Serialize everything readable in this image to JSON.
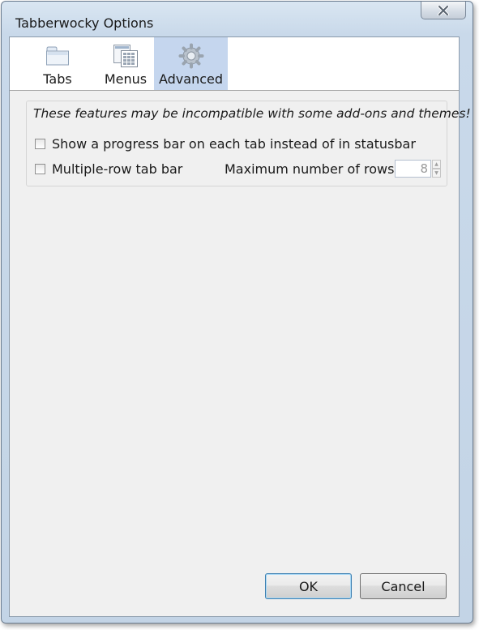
{
  "window": {
    "title": "Tabberwocky Options"
  },
  "toolbar": {
    "items": [
      {
        "label": "Tabs",
        "icon": "tabs-icon"
      },
      {
        "label": "Menus",
        "icon": "menus-icon"
      },
      {
        "label": "Advanced",
        "icon": "gear-icon",
        "selected": true
      }
    ]
  },
  "advanced": {
    "warning": "These features may be incompatible with some add-ons and themes!",
    "progress_option": {
      "label": "Show a progress bar on each tab instead of in statusbar",
      "checked": false
    },
    "multirow_option": {
      "label": "Multiple-row tab bar",
      "checked": false
    },
    "max_rows_label": "Maximum number of rows",
    "max_rows_value": "8"
  },
  "buttons": {
    "ok": "OK",
    "cancel": "Cancel"
  },
  "colors": {
    "selected_tab": "#c5d6ee",
    "client_bg": "#f0f0f0",
    "title_glass": "#c9d9ea"
  }
}
